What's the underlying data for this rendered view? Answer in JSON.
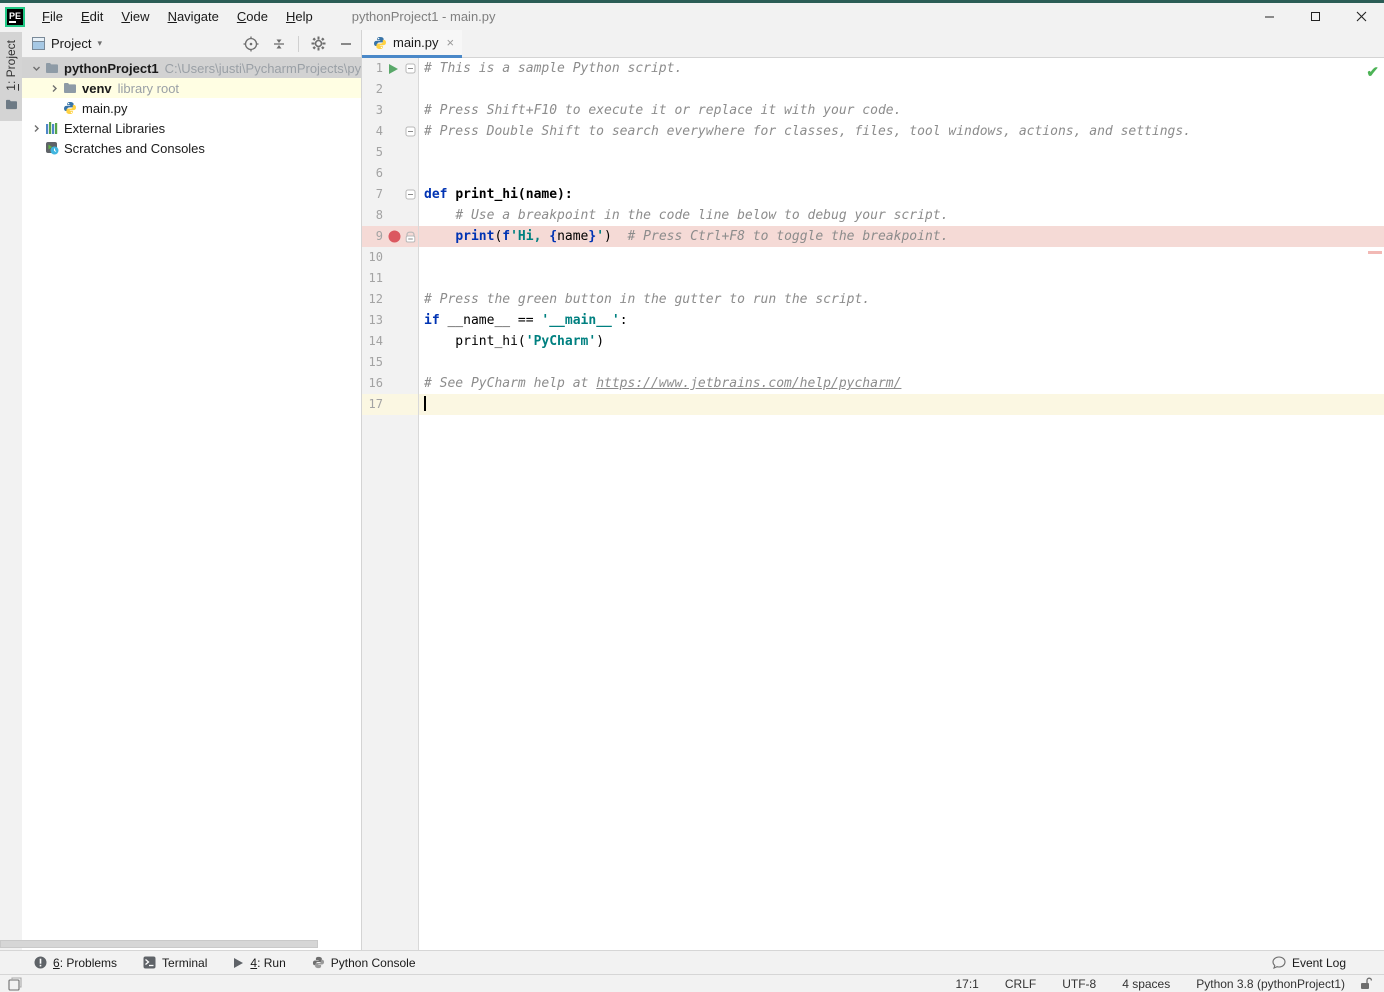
{
  "colors": {
    "top_border": "#2b5d56",
    "bar_bg": "#f2f2f2",
    "tab_accent": "#4a88c8",
    "breakpoint_red": "#db5860",
    "run_green": "#59a869",
    "ok_green": "#4db356",
    "keyword": "#0033b3",
    "string": "#008080",
    "comment": "#8c8c8c",
    "breakpoint_line_bg": "#f5dad6",
    "caret_line_bg": "#fbf7e2",
    "selection_bg": "#d2d2d2",
    "venv_row_bg": "#fffee3"
  },
  "titlebar": {
    "logo": "PE",
    "title": "pythonProject1 - main.py",
    "menus": [
      {
        "label": "File",
        "mnemonic": "F"
      },
      {
        "label": "Edit",
        "mnemonic": "E"
      },
      {
        "label": "View",
        "mnemonic": "V"
      },
      {
        "label": "Navigate",
        "mnemonic": "N"
      },
      {
        "label": "Code",
        "mnemonic": "C"
      },
      {
        "label": "Help",
        "mnemonic": "H"
      }
    ],
    "controls": [
      {
        "name": "minimize",
        "icon": "minimize-icon"
      },
      {
        "name": "maximize",
        "icon": "maximize-icon"
      },
      {
        "name": "close",
        "icon": "close-icon"
      }
    ]
  },
  "stripe": {
    "label": "1: Project",
    "mnemonic": "1",
    "icon": "folder-stripe"
  },
  "project_panel": {
    "header": {
      "label": "Project",
      "combo_arrow": "▾"
    },
    "header_icons": [
      {
        "name": "locate",
        "icon": "target"
      },
      {
        "name": "collapse-all",
        "icon": "collapse"
      },
      {
        "name": "settings",
        "icon": "gear"
      },
      {
        "name": "hide",
        "icon": "minus"
      }
    ],
    "tree": [
      {
        "label": "pythonProject1",
        "suffix": "C:\\Users\\justi\\PycharmProjects\\pythor",
        "icon": "folder",
        "chevron": "down",
        "depth": 0,
        "bold": true,
        "state": "selected"
      },
      {
        "label": "venv",
        "suffix": "library root",
        "icon": "folder",
        "chevron": "right",
        "depth": 1,
        "bold": true,
        "state": "cream"
      },
      {
        "label": "main.py",
        "icon": "python",
        "chevron": "none",
        "depth": 1,
        "icon_indent": true
      },
      {
        "label": "External Libraries",
        "icon": "library",
        "chevron": "right",
        "depth": 0
      },
      {
        "label": "Scratches and Consoles",
        "icon": "scratches",
        "chevron": "none",
        "depth": 0,
        "icon_indent": true
      }
    ]
  },
  "tabs": [
    {
      "label": "main.py",
      "icon": "python",
      "close": "×",
      "active": true
    }
  ],
  "editor": {
    "inspection_ok": "✔",
    "lines": [
      {
        "n": 1,
        "gutter": {
          "icon": "run",
          "fold": "minus"
        },
        "tokens": [
          [
            "comment",
            "# This is a sample Python script."
          ]
        ]
      },
      {
        "n": 2,
        "tokens": []
      },
      {
        "n": 3,
        "tokens": [
          [
            "comment",
            "# Press Shift+F10 to execute it or replace it with your code."
          ]
        ]
      },
      {
        "n": 4,
        "gutter": {
          "fold": "minus"
        },
        "tokens": [
          [
            "comment",
            "# Press Double Shift to search everywhere for classes, files, tool windows, actions, and settings."
          ]
        ]
      },
      {
        "n": 5,
        "tokens": []
      },
      {
        "n": 6,
        "tokens": []
      },
      {
        "n": 7,
        "gutter": {
          "fold": "minus"
        },
        "tokens": [
          [
            "kw",
            "def"
          ],
          [
            "plain",
            " "
          ],
          [
            "fn",
            "print_hi(name):"
          ]
        ]
      },
      {
        "n": 8,
        "tokens": [
          [
            "plain",
            "    "
          ],
          [
            "comment",
            "# Use a breakpoint in the code line below to debug your script."
          ]
        ]
      },
      {
        "n": 9,
        "gutter": {
          "icon": "breakpoint",
          "fold": "lock"
        },
        "highlight": "breakpoint",
        "tokens": [
          [
            "plain",
            "    "
          ],
          [
            "kw",
            "print"
          ],
          [
            "plain",
            "("
          ],
          [
            "kw",
            "f"
          ],
          [
            "str",
            "'Hi, "
          ],
          [
            "brace",
            "{"
          ],
          [
            "plain",
            "name"
          ],
          [
            "brace",
            "}"
          ],
          [
            "str",
            "'"
          ],
          [
            "plain",
            ")  "
          ],
          [
            "comment",
            "# Press Ctrl+F8 to toggle the breakpoint."
          ]
        ]
      },
      {
        "n": 10,
        "tokens": []
      },
      {
        "n": 11,
        "tokens": []
      },
      {
        "n": 12,
        "tokens": [
          [
            "comment",
            "# Press the green button in the gutter to run the script."
          ]
        ]
      },
      {
        "n": 13,
        "tokens": [
          [
            "kw",
            "if"
          ],
          [
            "plain",
            " __name__ == "
          ],
          [
            "str",
            "'__main__'"
          ],
          [
            "plain",
            ":"
          ]
        ]
      },
      {
        "n": 14,
        "tokens": [
          [
            "plain",
            "    print_hi("
          ],
          [
            "str",
            "'PyCharm'"
          ],
          [
            "plain",
            ")"
          ]
        ]
      },
      {
        "n": 15,
        "tokens": []
      },
      {
        "n": 16,
        "tokens": [
          [
            "comment",
            "# See PyCharm help at "
          ],
          [
            "link",
            "https://www.jetbrains.com/help/pycharm/"
          ]
        ]
      },
      {
        "n": 17,
        "highlight": "caret",
        "caret": true,
        "tokens": []
      }
    ]
  },
  "bottom_bar": {
    "left": [
      {
        "label": "6: Problems",
        "mnemonic": "6",
        "icon": "problems"
      },
      {
        "label": "Terminal",
        "icon": "terminal"
      },
      {
        "label": "4: Run",
        "mnemonic": "4",
        "icon": "run-gray"
      },
      {
        "label": "Python Console",
        "icon": "python-gray"
      }
    ],
    "right": [
      {
        "label": "Event Log",
        "icon": "event-log"
      }
    ]
  },
  "status_bar": {
    "left_icon": "tool-windows",
    "items": [
      "17:1",
      "CRLF",
      "UTF-8",
      "4 spaces",
      "Python 3.8 (pythonProject1)"
    ],
    "lock_icon": "unlocked-padlock"
  }
}
